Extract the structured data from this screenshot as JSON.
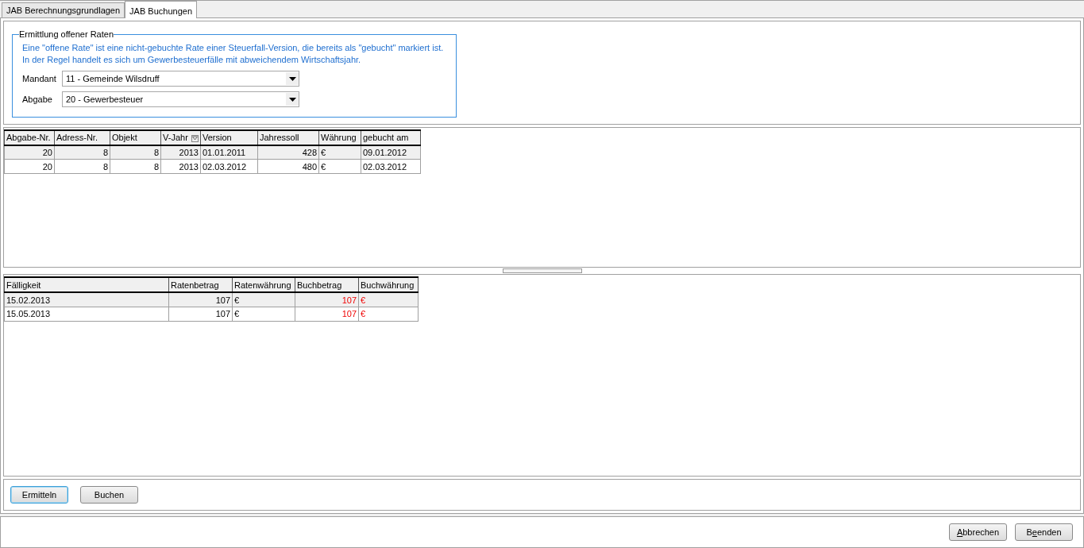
{
  "tabs": [
    {
      "label": "JAB Berechnungsgrundlagen",
      "selected": false
    },
    {
      "label": "JAB Buchungen",
      "selected": true
    }
  ],
  "group": {
    "title": "Ermittlung offener Raten",
    "info": [
      "Eine \"offene Rate\" ist eine nicht-gebuchte Rate einer Steuerfall-Version, die bereits als \"gebucht\" markiert ist.",
      "In der Regel handelt es sich um Gewerbesteuerfälle mit abweichendem Wirtschaftsjahr."
    ],
    "fields": [
      {
        "label": "Mandant",
        "value": "11 - Gemeinde Wilsdruff"
      },
      {
        "label": "Abgabe",
        "value": "20 - Gewerbesteuer"
      }
    ]
  },
  "versions_table": {
    "columns": [
      {
        "label": "Abgabe-Nr.",
        "kind": "number",
        "filter": false
      },
      {
        "label": "Adress-Nr.",
        "kind": "number",
        "filter": false
      },
      {
        "label": "Objekt",
        "kind": "number",
        "filter": false
      },
      {
        "label": "V-Jahr",
        "kind": "number",
        "filter": true
      },
      {
        "label": "Version",
        "kind": "text",
        "filter": false
      },
      {
        "label": "Jahressoll",
        "kind": "number",
        "filter": false
      },
      {
        "label": "Währung",
        "kind": "text",
        "filter": false
      },
      {
        "label": "gebucht am",
        "kind": "text",
        "filter": false
      }
    ],
    "rows": [
      {
        "selected": true,
        "cells": [
          "20",
          "8",
          "8",
          "2013",
          "01.01.2011",
          "428",
          "€",
          "09.01.2012"
        ]
      },
      {
        "selected": false,
        "cells": [
          "20",
          "8",
          "8",
          "2013",
          "02.03.2012",
          "480",
          "€",
          "02.03.2012"
        ]
      }
    ]
  },
  "rates_table": {
    "columns": [
      {
        "label": "Fälligkeit",
        "kind": "text"
      },
      {
        "label": "Ratenbetrag",
        "kind": "number"
      },
      {
        "label": "Ratenwährung",
        "kind": "text"
      },
      {
        "label": "Buchbetrag",
        "kind": "booked_number"
      },
      {
        "label": "Buchwährung",
        "kind": "booked_text"
      }
    ],
    "rows": [
      {
        "selected": true,
        "cells": [
          "15.02.2013",
          "107",
          "€",
          "107",
          "€"
        ]
      },
      {
        "selected": false,
        "cells": [
          "15.05.2013",
          "107",
          "€",
          "107",
          "€"
        ]
      }
    ]
  },
  "actions": [
    {
      "label": "Ermitteln",
      "focused": true
    },
    {
      "label": "Buchen",
      "focused": false
    }
  ],
  "footer_buttons": [
    {
      "mnemonic": "A",
      "after": "bbrechen"
    },
    {
      "before": "B",
      "mnemonic": "e",
      "after": "enden"
    }
  ]
}
